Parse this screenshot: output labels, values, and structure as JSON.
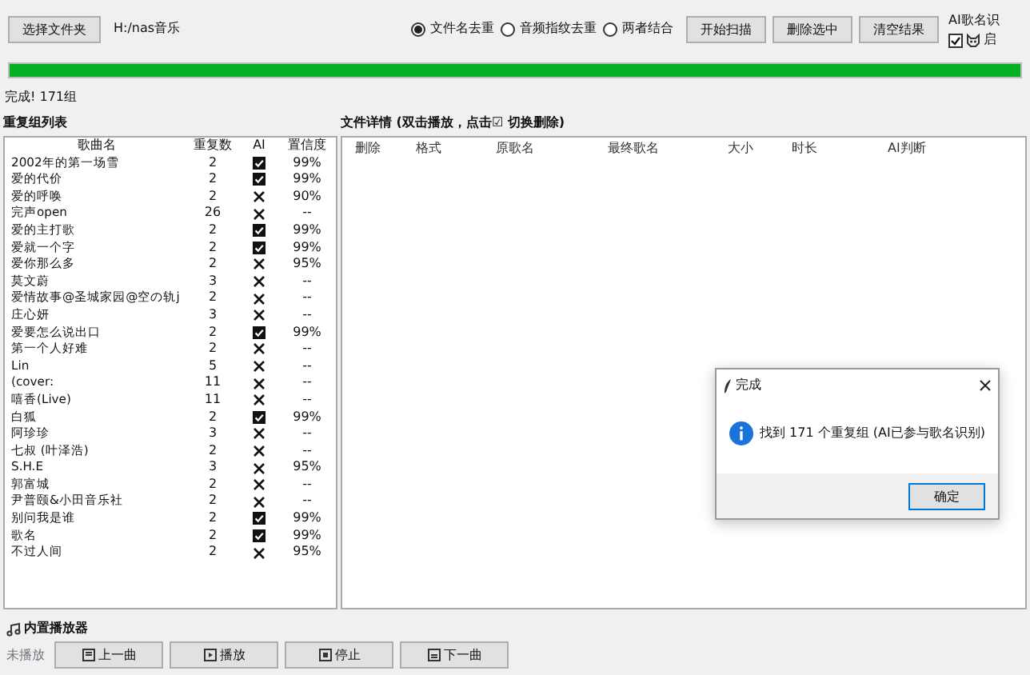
{
  "toolbar": {
    "folder_button": "选择文件夹",
    "folder_path": "H:/nas音乐",
    "modes": [
      {
        "label": "文件名去重",
        "selected": true
      },
      {
        "label": "音频指纹去重",
        "selected": false
      },
      {
        "label": "两者结合",
        "selected": false
      }
    ],
    "buttons": [
      "开始扫描",
      "删除选中",
      "清空结果"
    ],
    "ai_group": {
      "title": "AI歌名识",
      "checkbox": {
        "label": "启",
        "checked": true
      }
    }
  },
  "progress": {
    "level": 1.0
  },
  "status": "完成! 171组",
  "groups": {
    "title": "重复组列表",
    "columns": [
      "歌曲名",
      "重复数",
      "AI",
      "置信度"
    ],
    "rows": [
      {
        "name": "2002年的第一场雪",
        "count": "2",
        "ai": true,
        "confidence": "99%"
      },
      {
        "name": "爱的代价",
        "count": "2",
        "ai": true,
        "confidence": "99%"
      },
      {
        "name": "爱的呼唤",
        "count": "2",
        "ai": false,
        "confidence": "90%"
      },
      {
        "name": "完声open",
        "count": "26",
        "ai": false,
        "confidence": "--"
      },
      {
        "name": "爱的主打歌",
        "count": "2",
        "ai": true,
        "confidence": "99%"
      },
      {
        "name": "爱就一个字",
        "count": "2",
        "ai": true,
        "confidence": "99%"
      },
      {
        "name": "爱你那么多",
        "count": "2",
        "ai": false,
        "confidence": "95%"
      },
      {
        "name": "莫文蔚",
        "count": "3",
        "ai": false,
        "confidence": "--"
      },
      {
        "name": "爱情故事@圣城家园@空の轨j",
        "count": "2",
        "ai": false,
        "confidence": "--"
      },
      {
        "name": "庄心妍",
        "count": "3",
        "ai": false,
        "confidence": "--"
      },
      {
        "name": "爱要怎么说出口",
        "count": "2",
        "ai": true,
        "confidence": "99%"
      },
      {
        "name": "第一个人好难",
        "count": "2",
        "ai": false,
        "confidence": "--"
      },
      {
        "name": "Lin",
        "count": "5",
        "ai": false,
        "confidence": "--"
      },
      {
        "name": "(cover:",
        "count": "11",
        "ai": false,
        "confidence": "--"
      },
      {
        "name": "嘻香(Live)",
        "count": "11",
        "ai": false,
        "confidence": "--"
      },
      {
        "name": "白狐",
        "count": "2",
        "ai": true,
        "confidence": "99%"
      },
      {
        "name": "阿珍珍",
        "count": "3",
        "ai": false,
        "confidence": "--"
      },
      {
        "name": "七叔 (叶泽浩)",
        "count": "2",
        "ai": false,
        "confidence": "--"
      },
      {
        "name": "S.H.E",
        "count": "3",
        "ai": false,
        "confidence": "95%"
      },
      {
        "name": "郭富城",
        "count": "2",
        "ai": false,
        "confidence": "--"
      },
      {
        "name": "尹普颐&小田音乐社",
        "count": "2",
        "ai": false,
        "confidence": "--"
      },
      {
        "name": "别问我是谁",
        "count": "2",
        "ai": true,
        "confidence": "99%"
      },
      {
        "name": "歌名",
        "count": "2",
        "ai": true,
        "confidence": "99%"
      },
      {
        "name": "不过人间",
        "count": "2",
        "ai": false,
        "confidence": "95%"
      }
    ]
  },
  "details": {
    "title": "文件详情 (双击播放，点击☑  切换删除)",
    "columns": [
      "删除",
      "格式",
      "原歌名",
      "最终歌名",
      "大小",
      "时长",
      "AI判断"
    ]
  },
  "dialog": {
    "title": "完成",
    "message": "找到 171 个重复组 (AI已参与歌名识别)",
    "ok": "确定"
  },
  "player": {
    "title": "内置播放器",
    "state": "未播放",
    "buttons": [
      {
        "kind": "prev",
        "label": "上一曲"
      },
      {
        "kind": "play",
        "label": "播放"
      },
      {
        "kind": "stop",
        "label": "停止"
      },
      {
        "kind": "next",
        "label": "下一曲"
      }
    ]
  }
}
